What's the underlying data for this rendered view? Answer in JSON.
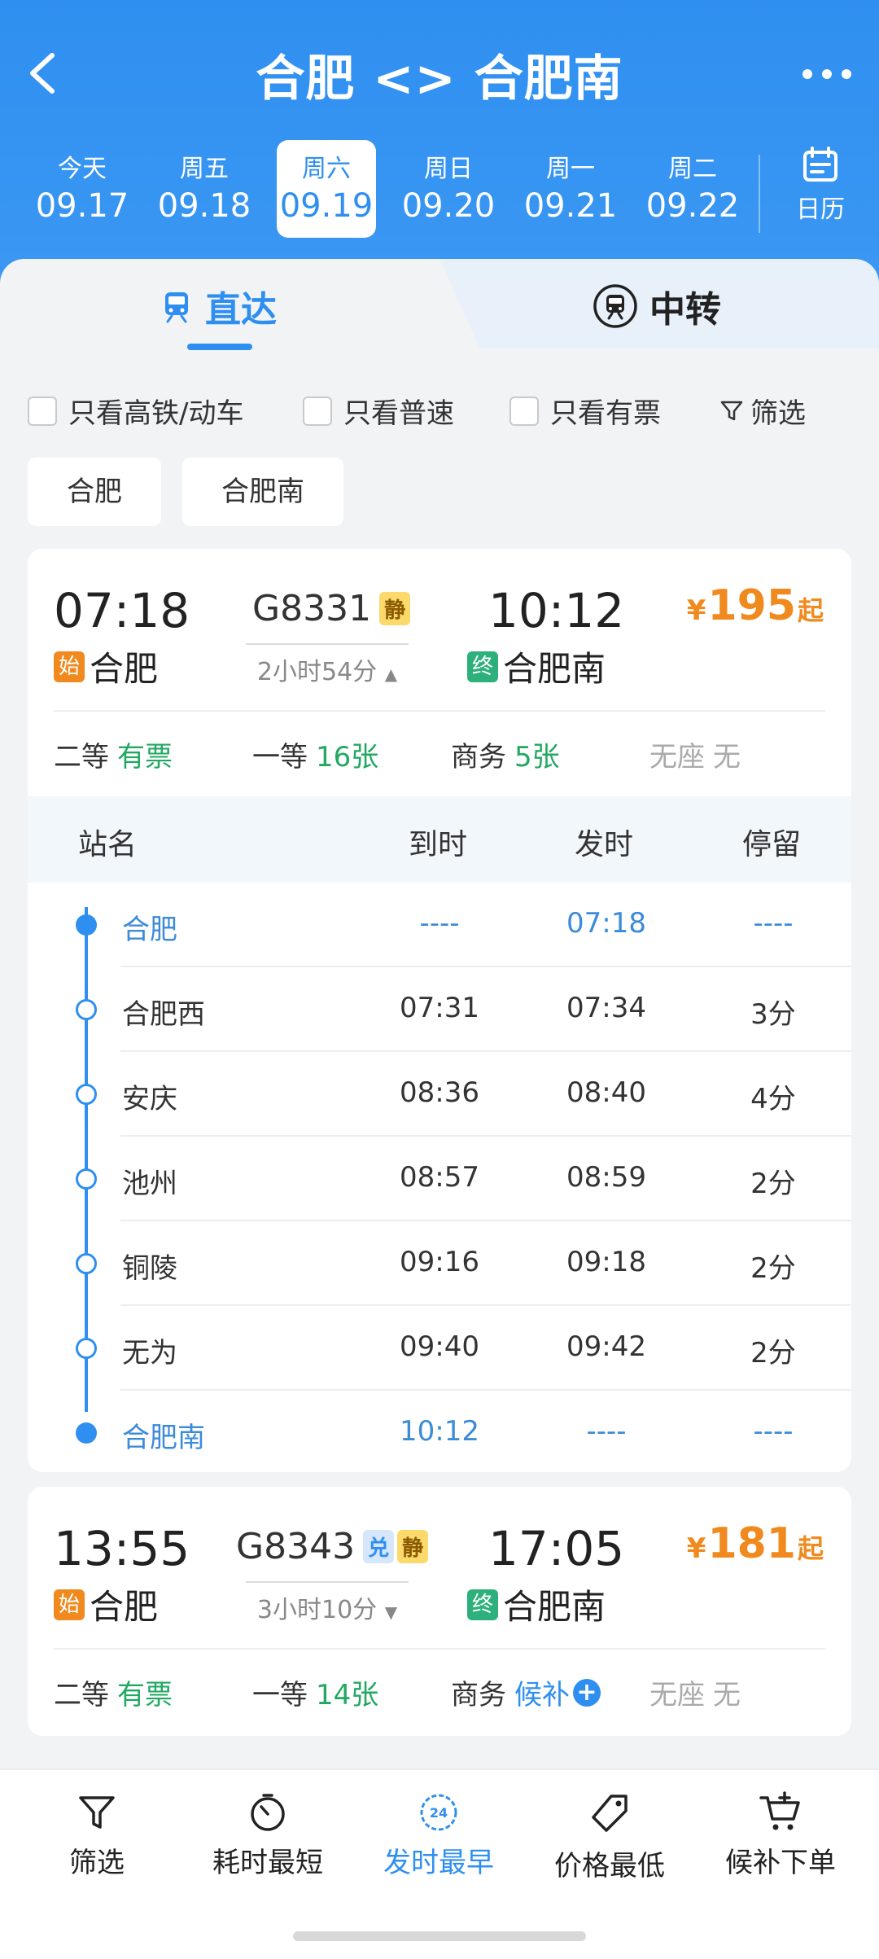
{
  "header": {
    "route_title": "合肥 <> 合肥南",
    "dates": [
      {
        "weekday": "今天",
        "date": "09.17",
        "active": false
      },
      {
        "weekday": "周五",
        "date": "09.18",
        "active": false
      },
      {
        "weekday": "周六",
        "date": "09.19",
        "active": true
      },
      {
        "weekday": "周日",
        "date": "09.20",
        "active": false
      },
      {
        "weekday": "周一",
        "date": "09.21",
        "active": false
      },
      {
        "weekday": "周二",
        "date": "09.22",
        "active": false
      }
    ],
    "calendar_label": "日历"
  },
  "tabs": {
    "direct": "直达",
    "transfer": "中转"
  },
  "filters": {
    "high_speed_only": "只看高铁/动车",
    "normal_only": "只看普速",
    "available_only": "只看有票",
    "filter": "筛选"
  },
  "station_tags": [
    "合肥",
    "合肥南"
  ],
  "trains": [
    {
      "dep_time": "07:18",
      "arr_time": "10:12",
      "train_no": "G8331",
      "badges": [
        "静"
      ],
      "duration": "2小时54分",
      "price_currency": "¥",
      "price": "195",
      "price_suffix": "起",
      "dep_tag": "始",
      "dep_station": "合肥",
      "arr_tag": "终",
      "arr_station": "合肥南",
      "seats": [
        {
          "class": "二等",
          "value": "有票"
        },
        {
          "class": "一等",
          "value": "16张"
        },
        {
          "class": "商务",
          "value": "5张"
        },
        {
          "class": "无座",
          "value": "无"
        }
      ],
      "stops_header": {
        "name": "站名",
        "arrive": "到时",
        "depart": "发时",
        "stay": "停留"
      },
      "stops": [
        {
          "name": "合肥",
          "arrive": "----",
          "depart": "07:18",
          "stay": "----"
        },
        {
          "name": "合肥西",
          "arrive": "07:31",
          "depart": "07:34",
          "stay": "3分"
        },
        {
          "name": "安庆",
          "arrive": "08:36",
          "depart": "08:40",
          "stay": "4分"
        },
        {
          "name": "池州",
          "arrive": "08:57",
          "depart": "08:59",
          "stay": "2分"
        },
        {
          "name": "铜陵",
          "arrive": "09:16",
          "depart": "09:18",
          "stay": "2分"
        },
        {
          "name": "无为",
          "arrive": "09:40",
          "depart": "09:42",
          "stay": "2分"
        },
        {
          "name": "合肥南",
          "arrive": "10:12",
          "depart": "----",
          "stay": "----"
        }
      ]
    },
    {
      "dep_time": "13:55",
      "arr_time": "17:05",
      "train_no": "G8343",
      "badges": [
        "兑",
        "静"
      ],
      "duration": "3小时10分",
      "price_currency": "¥",
      "price": "181",
      "price_suffix": "起",
      "dep_tag": "始",
      "dep_station": "合肥",
      "arr_tag": "终",
      "arr_station": "合肥南",
      "seats": [
        {
          "class": "二等",
          "value": "有票"
        },
        {
          "class": "一等",
          "value": "14张"
        },
        {
          "class": "商务",
          "value": "候补"
        },
        {
          "class": "无座",
          "value": "无"
        }
      ]
    }
  ],
  "toolbar": {
    "filter": "筛选",
    "shortest": "耗时最短",
    "earliest": "发时最早",
    "earliest_icon_text": "24",
    "cheapest": "价格最低",
    "waitlist": "候补下单"
  },
  "colors": {
    "primary": "#2f8ff0",
    "price": "#f08a1e",
    "available": "#22a862",
    "start_tag": "#f08a1e",
    "end_tag": "#2db07b"
  }
}
